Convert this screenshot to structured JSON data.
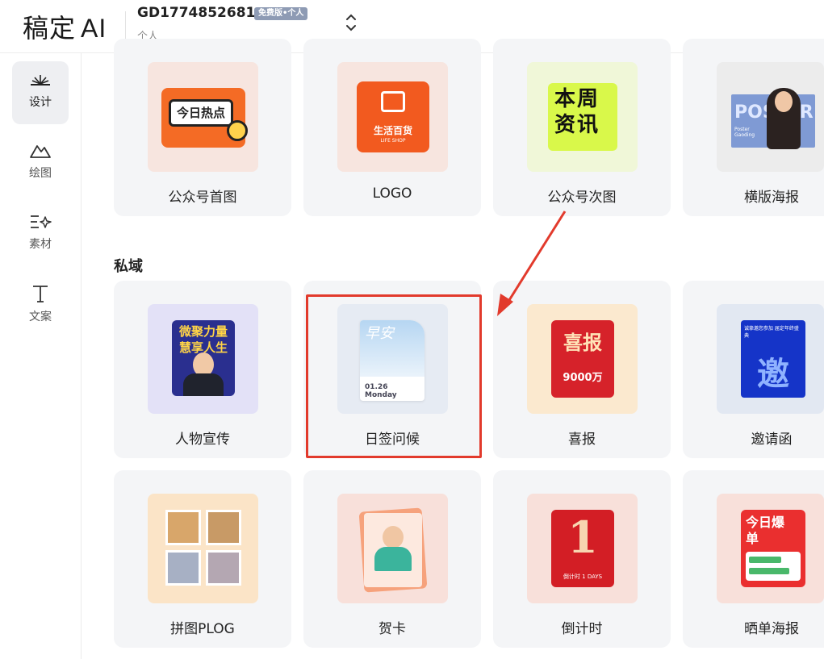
{
  "header": {
    "logo_text": "稿定",
    "logo_ai": "AI",
    "team_name": "GD1774852681",
    "team_badge": "免费版•个人",
    "team_sub": "个人"
  },
  "sidebar": {
    "items": [
      {
        "label": "设计",
        "icon": "design-icon",
        "active": true
      },
      {
        "label": "绘图",
        "icon": "draw-icon",
        "active": false
      },
      {
        "label": "素材",
        "icon": "material-icon",
        "active": false
      },
      {
        "label": "文案",
        "icon": "text-icon",
        "active": false
      }
    ]
  },
  "row1": [
    {
      "caption": "公众号首图",
      "thumb_text": "今日热点",
      "thumb_bg": "#f7e5df"
    },
    {
      "caption": "LOGO",
      "thumb_text": "生活百货",
      "thumb_sub": "LIFE SHOP",
      "thumb_bg": "#f7e5df"
    },
    {
      "caption": "公众号次图",
      "thumb_text": "本周资讯",
      "thumb_bg": "#f0f7d8"
    },
    {
      "caption": "横版海报",
      "thumb_text": "POSTER",
      "thumb_sub": "Poster Gaoding",
      "thumb_bg": "#ececec"
    }
  ],
  "section": {
    "title": "私域"
  },
  "row2": [
    {
      "caption": "人物宣传",
      "thumb_text": "微聚力量 慧享人生",
      "thumb_bg": "#e3e1f7"
    },
    {
      "caption": "日签问候",
      "thumb_text": "早安",
      "thumb_sub": "01.26 Monday",
      "thumb_bg": "#e6ebf3"
    },
    {
      "caption": "喜报",
      "thumb_text": "喜报",
      "thumb_sub": "9000万",
      "thumb_bg": "#fbe9cf"
    },
    {
      "caption": "邀请函",
      "thumb_text": "邀",
      "thumb_sub": "诚挚邀您参加 届定年终盛典",
      "thumb_bg": "#e2e8f2"
    }
  ],
  "row3": [
    {
      "caption": "拼图PLOG",
      "thumb_bg": "#fbe4c7"
    },
    {
      "caption": "贺卡",
      "thumb_bg": "#f8e0da"
    },
    {
      "caption": "倒计时",
      "thumb_text": "1",
      "thumb_sub": "倒计时 1 DAYS",
      "thumb_bg": "#f8e0da"
    },
    {
      "caption": "晒单海报",
      "thumb_text": "今日爆单",
      "thumb_bg": "#f8e0da"
    }
  ],
  "colors": {
    "accent_red": "#e23a2c",
    "badge": "#8e9bb4"
  }
}
